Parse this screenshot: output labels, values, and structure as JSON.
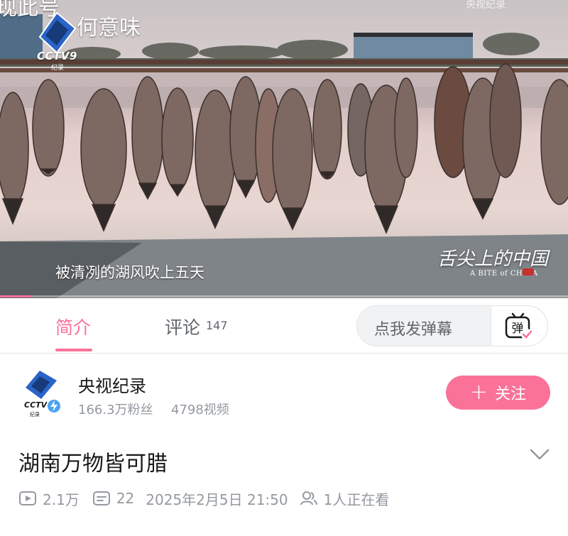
{
  "video": {
    "top_caption": "何意味",
    "top_left_partial": "现此号",
    "channel_logo": "CCTV9",
    "channel_logo_sub": "纪录",
    "top_right_watermark": "央视纪录",
    "subtitle": "被清冽的湖风吹上五天",
    "brand_cn": "舌尖上的中国",
    "brand_en": "A BITE of CHINA",
    "progress": 0.055
  },
  "tabs": {
    "intro": "简介",
    "comments": "评论",
    "comments_count": "147"
  },
  "danmaku": {
    "placeholder": "点我发弹幕",
    "icon": "danmaku-icon",
    "icon_char": "弹"
  },
  "uploader": {
    "name": "央视纪录",
    "avatar_text": "CCTV",
    "avatar_sub": "纪录",
    "fans": "166.3万粉丝",
    "videos": "4798视频",
    "follow_label": "关注",
    "follow_symbol": "+"
  },
  "title": "湖南万物皆可腊",
  "stats": {
    "views": "2.1万",
    "danmaku_count": "22",
    "datetime": "2025年2月5日 21:50",
    "watching": "1人正在看"
  },
  "colors": {
    "accent": "#fb7299",
    "muted": "#9499a0",
    "text": "#18191c"
  }
}
